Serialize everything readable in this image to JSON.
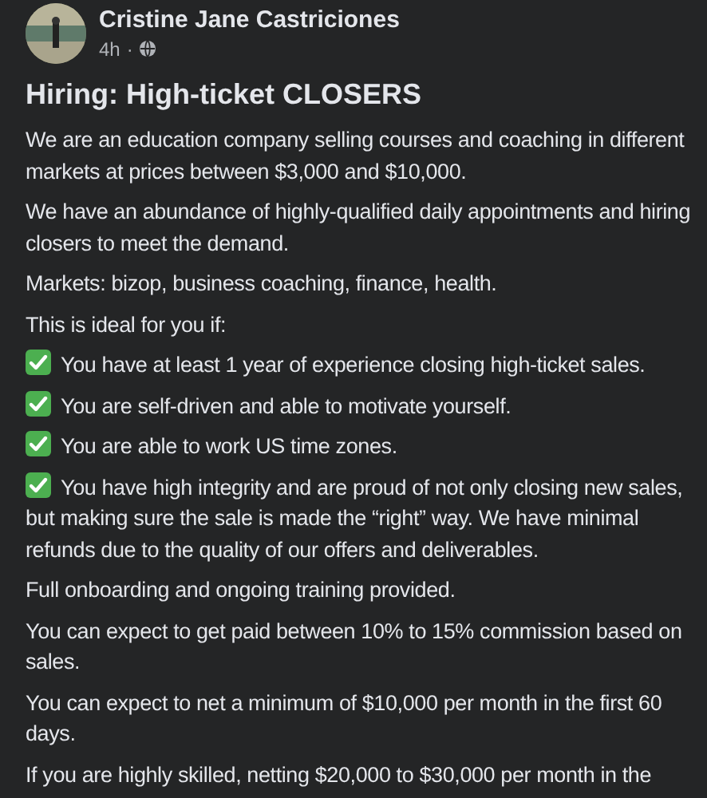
{
  "post": {
    "author": "Cristine Jane Castriciones",
    "time": "4h",
    "separator": "·",
    "title": "Hiring: High-ticket CLOSERS",
    "blocks": [
      {
        "kind": "text",
        "text": "We are an education company selling courses and coaching in different markets at prices between $3,000 and $10,000."
      },
      {
        "kind": "text",
        "text": "We have an abundance of highly-qualified daily appointments and hiring closers to meet the demand."
      },
      {
        "kind": "text",
        "text": "Markets: bizop, business coaching, finance, health."
      },
      {
        "kind": "text",
        "text": "This is ideal for you if:"
      },
      {
        "kind": "check",
        "text": "You have at least 1 year of experience closing high-ticket sales."
      },
      {
        "kind": "check",
        "text": "You are self-driven and able to motivate yourself."
      },
      {
        "kind": "check",
        "text": "You are able to work US time zones."
      },
      {
        "kind": "check",
        "text": "You have high integrity and are proud of not only closing new sales, but making sure the sale is made the “right” way. We have minimal refunds due to the quality of our offers and deliverables."
      },
      {
        "kind": "text",
        "text": "Full onboarding and ongoing training provided."
      },
      {
        "kind": "text",
        "text": "You can expect to get paid between 10% to 15% commission based on sales."
      },
      {
        "kind": "text",
        "text": "You can expect to net a minimum of $10,000 per month in the first 60 days."
      },
      {
        "kind": "text",
        "text": "If you are highly skilled, netting $20,000 to $30,000 per month in the"
      }
    ]
  }
}
